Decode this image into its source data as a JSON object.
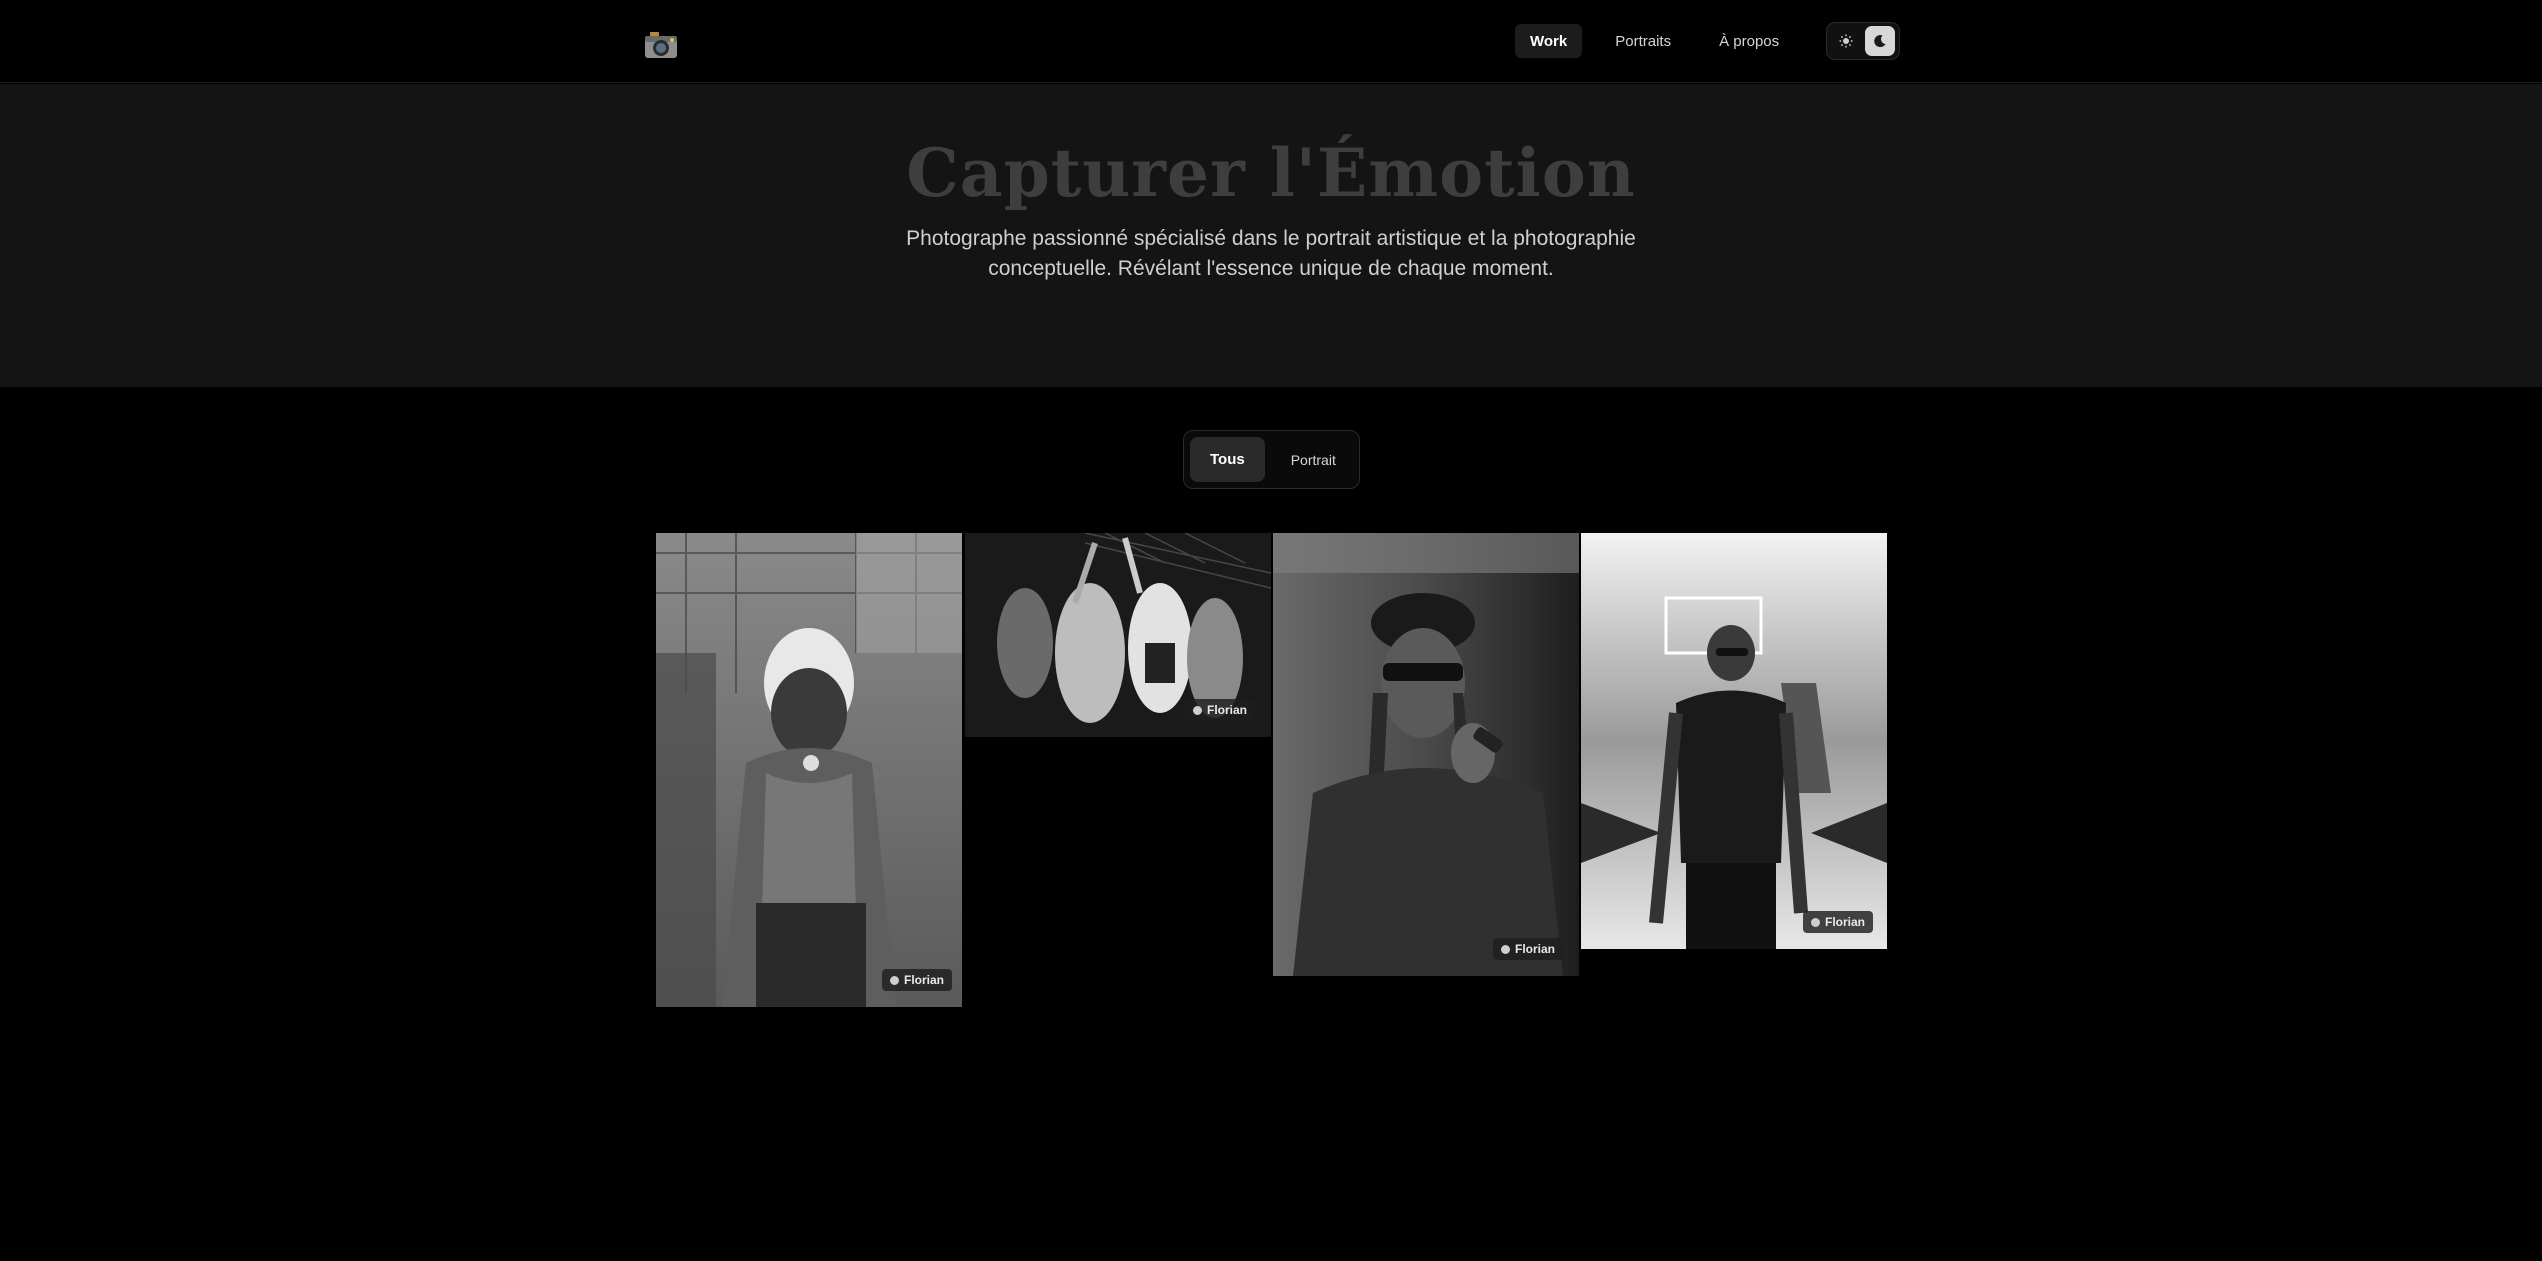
{
  "header": {
    "logo_icon": "camera-icon",
    "nav": [
      {
        "label": "Work",
        "active": true
      },
      {
        "label": "Portraits",
        "active": false
      },
      {
        "label": "À propos",
        "active": false
      }
    ],
    "theme": {
      "light_icon": "sun-icon",
      "dark_icon": "moon-icon",
      "selected": "dark"
    }
  },
  "hero": {
    "title": "Capturer l'Émotion",
    "subtitle": "Photographe passionné spécialisé dans le portrait artistique et la photographie conceptuelle. Révélant l'essence unique de chaque moment."
  },
  "filters": [
    {
      "label": "Tous",
      "active": true
    },
    {
      "label": "Portrait",
      "active": false
    }
  ],
  "gallery": [
    {
      "credit": "Florian"
    },
    {
      "credit": "Florian"
    },
    {
      "credit": "Florian"
    },
    {
      "credit": "Florian"
    }
  ],
  "colors": {
    "background": "#000000",
    "hero_background": "#141414",
    "title": "#3e3e3e"
  }
}
